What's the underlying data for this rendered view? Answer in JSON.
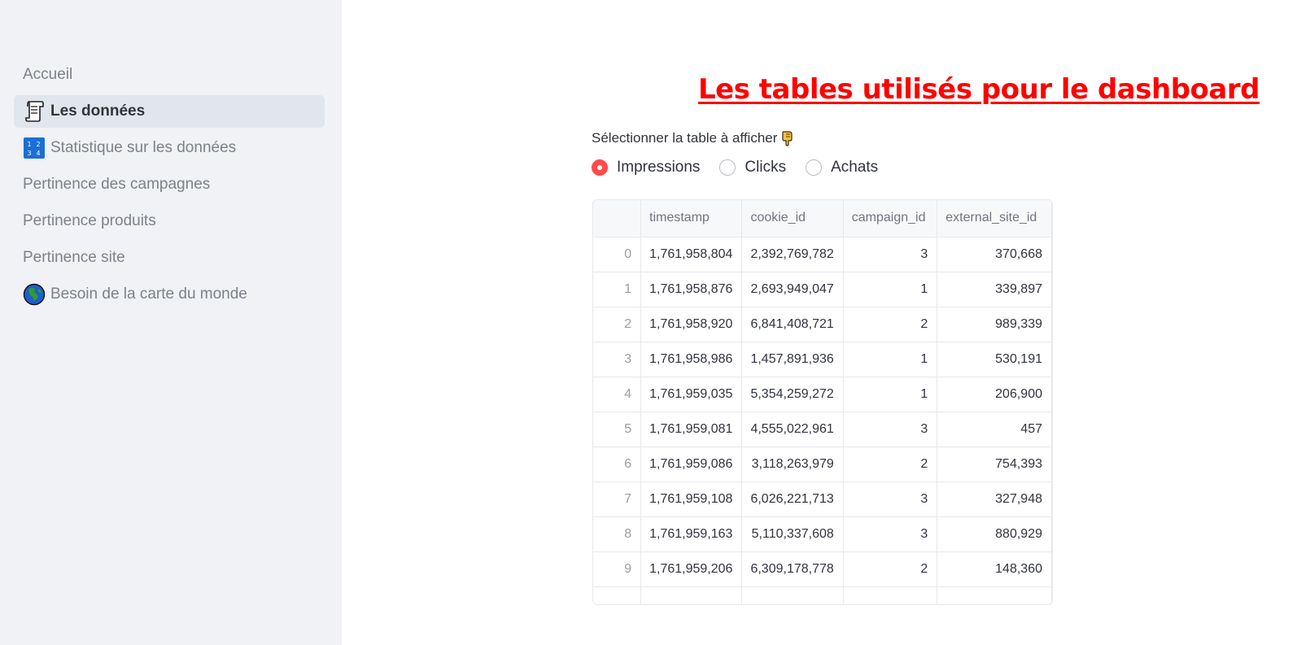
{
  "sidebar": {
    "items": [
      {
        "label": "Accueil",
        "icon": null,
        "active": false
      },
      {
        "label": "Les données",
        "icon": "page-scroll-icon",
        "active": true
      },
      {
        "label": "Statistique sur les données",
        "icon": "numbers-1234-icon",
        "active": false
      },
      {
        "label": "Pertinence des campagnes",
        "icon": null,
        "active": false
      },
      {
        "label": "Pertinence produits",
        "icon": null,
        "active": false
      },
      {
        "label": "Pertinence site",
        "icon": null,
        "active": false
      },
      {
        "label": "Besoin de la carte du monde",
        "icon": "globe-icon",
        "active": false
      }
    ]
  },
  "main": {
    "title": "Les tables utilisés pour le dashboard",
    "title_color": "#ff0000",
    "radio": {
      "label": "Sélectionner la table à afficher",
      "label_icon": "pointing-down-hand-icon",
      "options": [
        "Impressions",
        "Clicks",
        "Achats"
      ],
      "selected": "Impressions",
      "accent": "#ff4b4b"
    },
    "table": {
      "columns": [
        "",
        "timestamp",
        "cookie_id",
        "campaign_id",
        "external_site_id"
      ],
      "rows": [
        [
          "0",
          "1,761,958,804",
          "2,392,769,782",
          "3",
          "370,668"
        ],
        [
          "1",
          "1,761,958,876",
          "2,693,949,047",
          "1",
          "339,897"
        ],
        [
          "2",
          "1,761,958,920",
          "6,841,408,721",
          "2",
          "989,339"
        ],
        [
          "3",
          "1,761,958,986",
          "1,457,891,936",
          "1",
          "530,191"
        ],
        [
          "4",
          "1,761,959,035",
          "5,354,259,272",
          "1",
          "206,900"
        ],
        [
          "5",
          "1,761,959,081",
          "4,555,022,961",
          "3",
          "457"
        ],
        [
          "6",
          "1,761,959,086",
          "3,118,263,979",
          "2",
          "754,393"
        ],
        [
          "7",
          "1,761,959,108",
          "6,026,221,713",
          "3",
          "327,948"
        ],
        [
          "8",
          "1,761,959,163",
          "5,110,337,608",
          "3",
          "880,929"
        ],
        [
          "9",
          "1,761,959,206",
          "6,309,178,778",
          "2",
          "148,360"
        ]
      ]
    }
  }
}
